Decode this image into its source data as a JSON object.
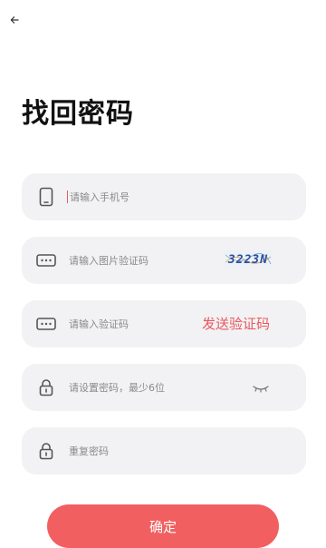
{
  "page": {
    "title": "找回密码"
  },
  "header": {
    "back_icon": "arrow-left-icon"
  },
  "fields": {
    "phone": {
      "placeholder": "请输入手机号",
      "icon": "phone-icon"
    },
    "image_code": {
      "placeholder": "请输入图片验证码",
      "icon": "dots-box-icon",
      "captcha_text": "3223N"
    },
    "sms_code": {
      "placeholder": "请输入验证码",
      "icon": "dots-box-icon",
      "send_label": "发送验证码"
    },
    "password": {
      "placeholder": "请设置密码，最少6位",
      "icon": "lock-icon",
      "toggle_icon": "eye-closed-icon"
    },
    "password_repeat": {
      "placeholder": "重复密码",
      "icon": "lock-icon"
    }
  },
  "actions": {
    "confirm_label": "确定"
  },
  "colors": {
    "accent": "#f25f60",
    "field_bg": "#f2f2f4",
    "text_muted": "#8a8a8e"
  }
}
